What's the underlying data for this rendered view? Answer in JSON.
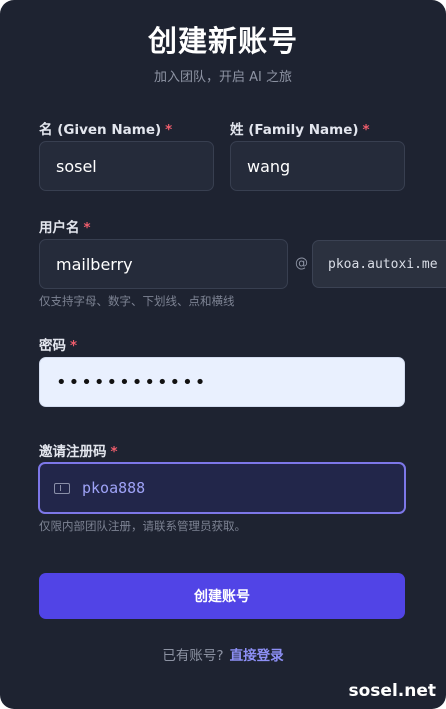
{
  "header": {
    "title": "创建新账号",
    "subtitle": "加入团队，开启 AI 之旅"
  },
  "form": {
    "required_mark": "*",
    "given_name": {
      "label": "名 (Given Name)",
      "value": "sosel"
    },
    "family_name": {
      "label": "姓 (Family Name)",
      "value": "wang"
    },
    "username": {
      "label": "用户名",
      "value": "mailberry",
      "at": "@",
      "domain": "pkoa.autoxi.me",
      "hint": "仅支持字母、数字、下划线、点和横线"
    },
    "password": {
      "label": "密码",
      "masked_value": "••••••••••••"
    },
    "invite_code": {
      "label": "邀请注册码",
      "value": "pkoa888",
      "icon": "ticket-icon",
      "hint": "仅限内部团队注册，请联系管理员获取。"
    },
    "submit_label": "创建账号"
  },
  "footer": {
    "prompt": "已有账号?",
    "login_link": "直接登录"
  },
  "watermark": "sosel.net",
  "colors": {
    "card_bg": "#1e2331",
    "accent": "#5144e6",
    "required": "#ef5d6c",
    "link": "#8d8ff5",
    "focus_border": "#7d77e8"
  }
}
